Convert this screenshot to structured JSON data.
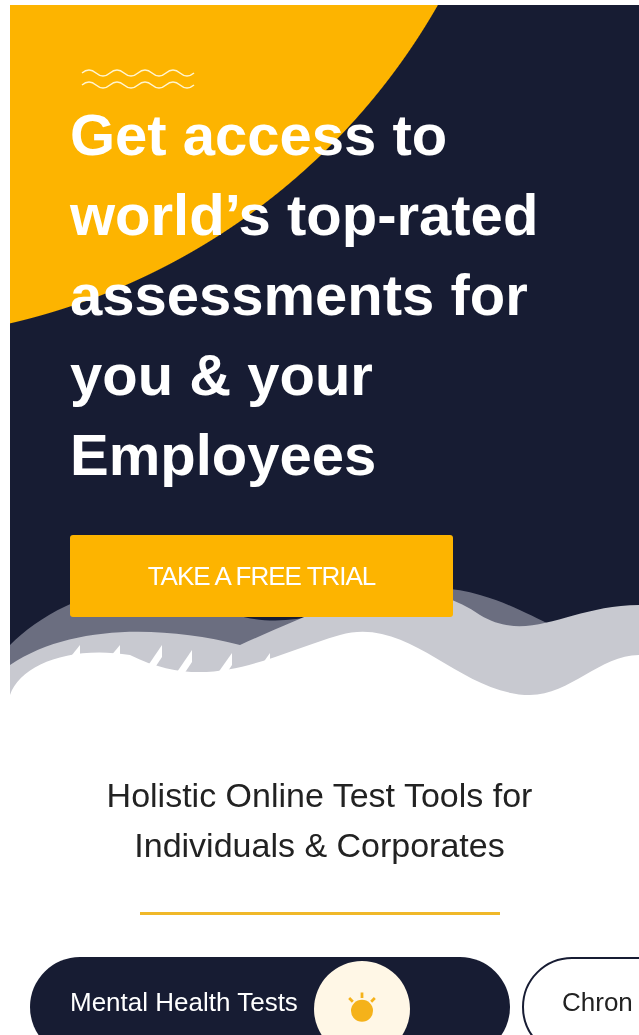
{
  "hero": {
    "heading": "Get access to world’s top-rated assessments for you & your Employees",
    "cta": "TAKE A FREE TRIAL"
  },
  "intro": {
    "heading": "Holistic Online Test Tools for Individuals & Corporates"
  },
  "categories": [
    {
      "label": "Mental Health Tests",
      "selected": true
    },
    {
      "label": "Chron",
      "selected": false
    }
  ]
}
